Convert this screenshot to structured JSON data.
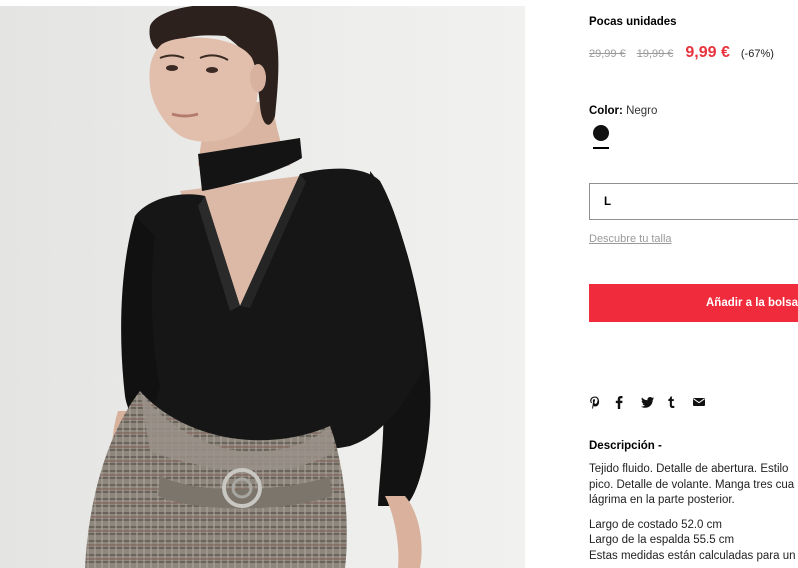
{
  "product": {
    "stock_label": "Pocas unidades",
    "price_original": "29,99 €",
    "price_previous": "19,99 €",
    "price_current": "9,99 €",
    "discount": "(-67%)",
    "color_label": "Color:",
    "color_value": "Negro",
    "color_swatch_hex": "#111111",
    "selected_size": "L",
    "size_guide_link": "Descubre tu talla",
    "add_to_bag": "Añadir a la bolsa",
    "share_icons": [
      "pinterest-icon",
      "facebook-icon",
      "twitter-icon",
      "tumblr-icon",
      "email-icon"
    ],
    "description_title": "Descripción -",
    "description_lines": [
      "Tejido fluido. Detalle de abertura. Estilo",
      "pico. Detalle de volante. Manga tres cua",
      "lágrima en la parte posterior."
    ],
    "measure_lines": [
      "Largo de costado 52.0 cm",
      "Largo de la espalda 55.5 cm",
      "Estas medidas están calculadas para un"
    ]
  },
  "colors": {
    "accent": "#f02c3c",
    "sale_price": "#e8333e",
    "muted": "#9a9a9a"
  }
}
